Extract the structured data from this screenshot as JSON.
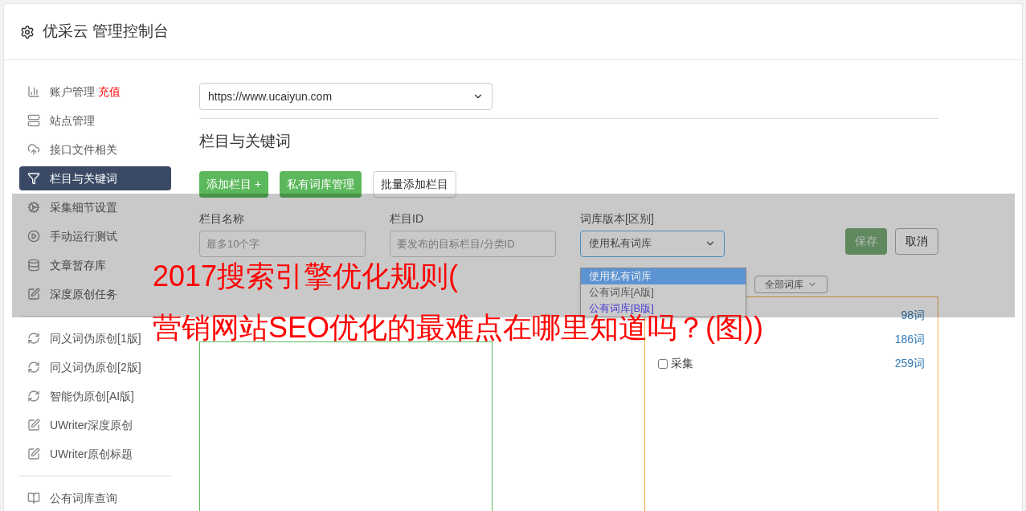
{
  "header": {
    "title": "优采云 管理控制台"
  },
  "sidebar": {
    "groups": [
      [
        {
          "label": "账户管理",
          "badge": "充值",
          "selected": false
        },
        {
          "label": "站点管理",
          "selected": false
        },
        {
          "label": "接口文件相关",
          "selected": false
        },
        {
          "label": "栏目与关键词",
          "selected": true
        },
        {
          "label": "采集细节设置",
          "selected": false
        },
        {
          "label": "手动运行测试",
          "selected": false
        },
        {
          "label": "文章暂存库",
          "selected": false
        },
        {
          "label": "深度原创任务",
          "selected": false
        }
      ],
      [
        {
          "label": "同义词伪原创[1版]",
          "selected": false
        },
        {
          "label": "同义词伪原创[2版]",
          "selected": false
        },
        {
          "label": "智能伪原创[AI版]",
          "selected": false
        },
        {
          "label": "UWriter深度原创",
          "selected": false
        },
        {
          "label": "UWriter原创标题",
          "selected": false
        }
      ],
      [
        {
          "label": "公有词库查询",
          "selected": false
        }
      ]
    ]
  },
  "site_select": {
    "value": "https://www.ucaiyun.com"
  },
  "section_title": "栏目与关键词",
  "buttons": [
    {
      "label": "添加栏目 +",
      "kind": "primary"
    },
    {
      "label": "私有词库管理",
      "kind": "primary"
    },
    {
      "label": "批量添加栏目",
      "kind": "default"
    }
  ],
  "form": {
    "name_field": {
      "label": "栏目名称",
      "placeholder": "最多10个字"
    },
    "id_field": {
      "label": "栏目ID",
      "placeholder": "要发布的目标栏目/分类ID"
    },
    "library_select": {
      "label": "词库版本[区别]",
      "value": "使用私有词库",
      "options": [
        {
          "label": "使用私有词库",
          "selected": true
        },
        {
          "label": "公有词库[A版]",
          "selected": false,
          "color": "#555555"
        },
        {
          "label": "公有词库[B版]",
          "selected": false,
          "color": "#4a3ad0"
        }
      ]
    },
    "save": "保存",
    "cancel": "取消"
  },
  "filter_select": {
    "value": "全部词库"
  },
  "library_list": [
    {
      "count": "98词"
    },
    {
      "count": "186词"
    },
    {
      "label": "采集",
      "checked": false,
      "count": "259词"
    }
  ],
  "overlay_title": [
    "2017搜索引擎优化规则(",
    "营销网站SEO优化的最难点在哪里知道吗？(图))"
  ]
}
